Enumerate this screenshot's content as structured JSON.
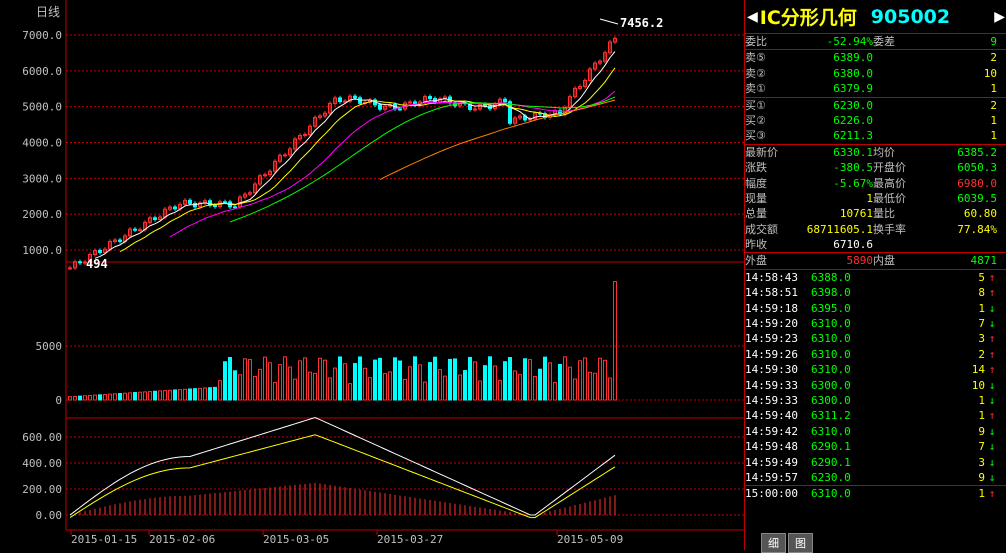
{
  "chart_title": "日线",
  "price_axis": {
    "labels": [
      "7000.0",
      "6000.0",
      "5000.0",
      "4000.0",
      "3000.0",
      "2000.0",
      "1000.0"
    ],
    "values": [
      7000,
      6000,
      5000,
      4000,
      3000,
      2000,
      1000
    ]
  },
  "volume_axis": {
    "labels": [
      "5000",
      "0"
    ],
    "values": [
      5000,
      0
    ]
  },
  "macd_axis": {
    "labels": [
      "600.00",
      "400.00",
      "200.00",
      "0.00"
    ],
    "values": [
      600,
      400,
      200,
      0
    ]
  },
  "date_labels": [
    "2015-01-15",
    "2015-02-06",
    "2015-03-05",
    "2015-03-27",
    "2015-05-09"
  ],
  "annotations": {
    "high": "7456.2",
    "low": "494"
  },
  "header": {
    "name": "IC分形几何",
    "code": "905002"
  },
  "weibi": {
    "label": "委比",
    "value": "-52.94%",
    "label2": "委差",
    "value2": "9"
  },
  "sell": [
    {
      "label": "卖⑤",
      "price": "6389.0",
      "vol": "2"
    },
    {
      "label": "卖②",
      "price": "6380.0",
      "vol": "10"
    },
    {
      "label": "卖①",
      "price": "6379.9",
      "vol": "1"
    }
  ],
  "buy": [
    {
      "label": "买①",
      "price": "6230.0",
      "vol": "2"
    },
    {
      "label": "买②",
      "price": "6226.0",
      "vol": "1"
    },
    {
      "label": "买③",
      "price": "6211.3",
      "vol": "1"
    }
  ],
  "stats": [
    {
      "l1": "最新价",
      "v1": "6330.1",
      "l2": "均价",
      "v2": "6385.2",
      "c1": "g",
      "c2": "g"
    },
    {
      "l1": "涨跌",
      "v1": "-380.5",
      "l2": "开盘价",
      "v2": "6050.3",
      "c1": "g",
      "c2": "g"
    },
    {
      "l1": "幅度",
      "v1": "-5.67%",
      "l2": "最高价",
      "v2": "6980.0",
      "c1": "g",
      "c2": "r"
    },
    {
      "l1": "现量",
      "v1": "1",
      "l2": "最低价",
      "v2": "6039.5",
      "c1": "y",
      "c2": "g"
    },
    {
      "l1": "总量",
      "v1": "10761",
      "l2": "量比",
      "v2": "60.80",
      "c1": "y",
      "c2": "y"
    },
    {
      "l1": "成交额",
      "v1": "68711605.1",
      "l2": "换手率",
      "v2": "77.84%",
      "c1": "y",
      "c2": "y"
    },
    {
      "l1": "昨收",
      "v1": "6710.6",
      "l2": "",
      "v2": "",
      "c1": "w",
      "c2": "w"
    }
  ],
  "outer": {
    "l1": "外盘",
    "v1": "5890",
    "l2": "内盘",
    "v2": "4871"
  },
  "ticks": [
    {
      "t": "14:58:43",
      "p": "6388.0",
      "v": "5",
      "d": "↑",
      "pc": "g",
      "dc": "r"
    },
    {
      "t": "14:58:51",
      "p": "6398.0",
      "v": "8",
      "d": "↑",
      "pc": "g",
      "dc": "r"
    },
    {
      "t": "14:59:18",
      "p": "6395.0",
      "v": "1",
      "d": "↓",
      "pc": "g",
      "dc": "g"
    },
    {
      "t": "14:59:20",
      "p": "6310.0",
      "v": "7",
      "d": "↓",
      "pc": "g",
      "dc": "g"
    },
    {
      "t": "14:59:23",
      "p": "6310.0",
      "v": "3",
      "d": "↑",
      "pc": "g",
      "dc": "r"
    },
    {
      "t": "14:59:26",
      "p": "6310.0",
      "v": "2",
      "d": "↑",
      "pc": "g",
      "dc": "r"
    },
    {
      "t": "14:59:30",
      "p": "6310.0",
      "v": "14",
      "d": "↑",
      "pc": "g",
      "dc": "r"
    },
    {
      "t": "14:59:33",
      "p": "6300.0",
      "v": "10",
      "d": "↓",
      "pc": "g",
      "dc": "g"
    },
    {
      "t": "14:59:33",
      "p": "6300.0",
      "v": "1",
      "d": "↓",
      "pc": "g",
      "dc": "g"
    },
    {
      "t": "14:59:40",
      "p": "6311.2",
      "v": "1",
      "d": "↑",
      "pc": "g",
      "dc": "r"
    },
    {
      "t": "14:59:42",
      "p": "6310.0",
      "v": "9",
      "d": "↓",
      "pc": "g",
      "dc": "g"
    },
    {
      "t": "14:59:48",
      "p": "6290.1",
      "v": "7",
      "d": "↓",
      "pc": "g",
      "dc": "g"
    },
    {
      "t": "14:59:49",
      "p": "6290.1",
      "v": "3",
      "d": "↓",
      "pc": "g",
      "dc": "g"
    },
    {
      "t": "14:59:57",
      "p": "6230.0",
      "v": "9",
      "d": "↓",
      "pc": "g",
      "dc": "g"
    },
    {
      "t": "15:00:00",
      "p": "6310.0",
      "v": "1",
      "d": "↑",
      "pc": "g",
      "dc": "r"
    }
  ],
  "tabs": [
    "细",
    "图"
  ],
  "colors": {
    "grid": "#c00000",
    "up": "#ff3030",
    "down": "#00ffff",
    "ma5": "#ffffff",
    "ma10": "#ffff00",
    "ma20": "#ff00ff",
    "ma30": "#00ff00",
    "ma60": "#ff8000"
  }
}
